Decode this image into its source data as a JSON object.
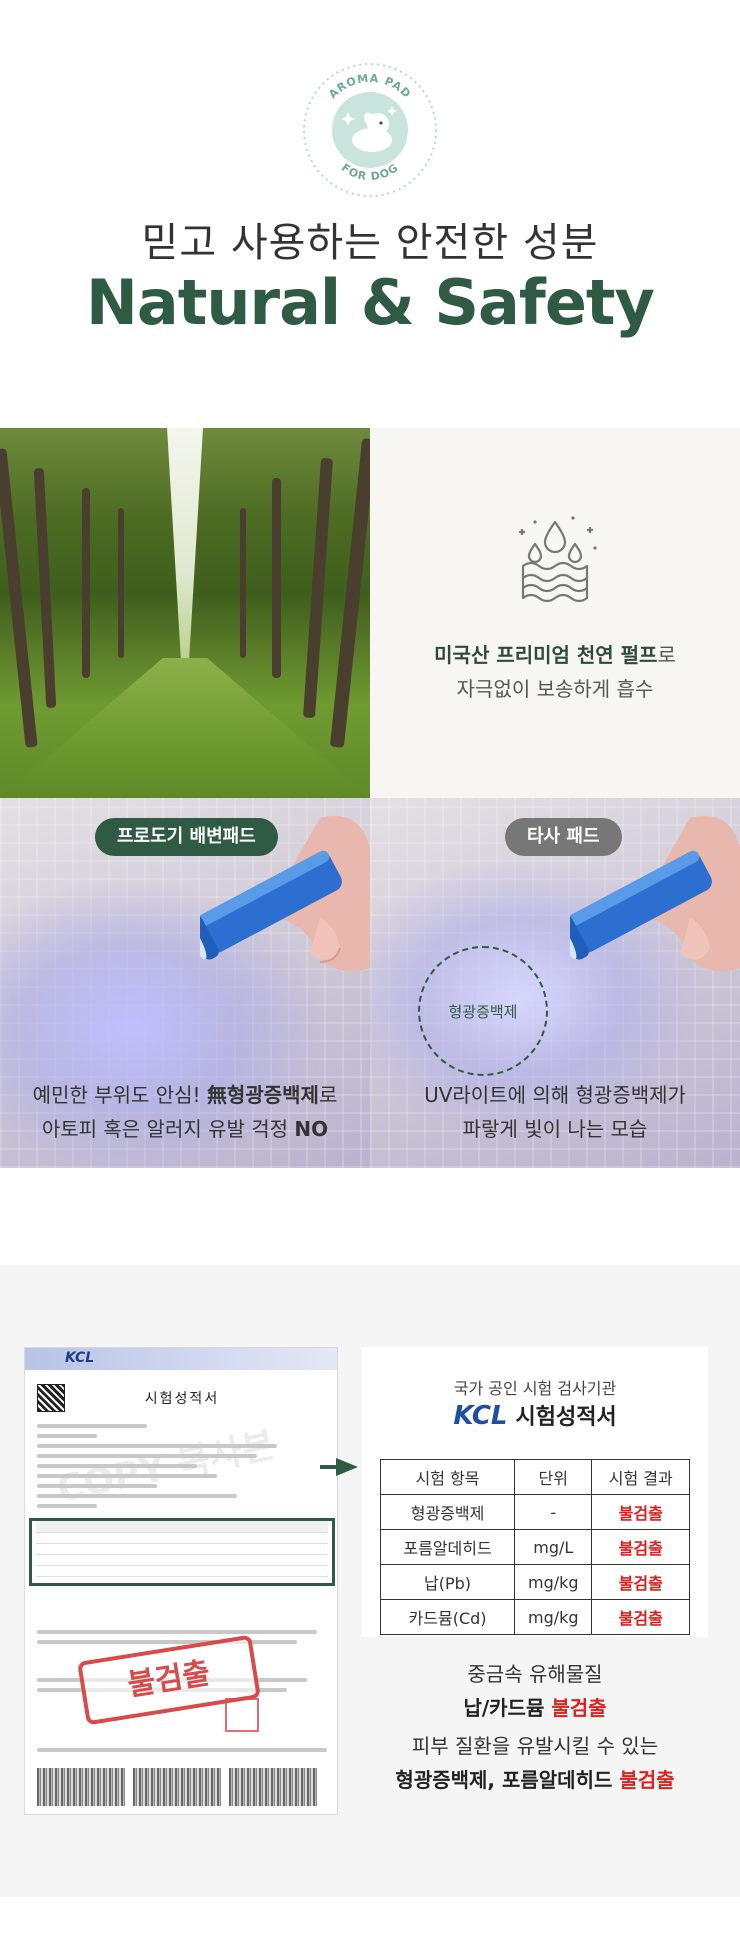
{
  "logo": {
    "top_text": "AROMA PAD",
    "bottom_text": "FOR DOG"
  },
  "header": {
    "title_ko": "믿고 사용하는 안전한 성분",
    "title_en": "Natural & Safety"
  },
  "pulp": {
    "highlight": "미국산 프리미엄 천연 펄프",
    "suffix": "로",
    "line2": "자극없이 보송하게 흡수"
  },
  "ours": {
    "badge": "프로도기 배변패드",
    "line1_prefix": "예민한 부위도 안심! ",
    "line1_bold": "無형광증백제",
    "line1_suffix": "로",
    "line2_prefix": "아토피 혹은 알러지 유발 걱정 ",
    "line2_bold": "NO"
  },
  "other": {
    "badge": "타사 패드",
    "circle_label": "형광증백제",
    "line1": "UV라이트에 의해 형광증백제가",
    "line2": "파랗게 빛이 나는 모습"
  },
  "document": {
    "brand": "KCL",
    "title": "시험성적서",
    "watermark": "COPY 복사본",
    "stamp": "불검출"
  },
  "results": {
    "subtitle": "국가 공인 시험 검사기관",
    "brand": "KCL",
    "title": "시험성적서",
    "headers": [
      "시험 항목",
      "단위",
      "시험 결과"
    ],
    "rows": [
      [
        "형광증백제",
        "-",
        "불검출"
      ],
      [
        "포름알데히드",
        "mg/L",
        "불검출"
      ],
      [
        "납(Pb)",
        "mg/kg",
        "불검출"
      ],
      [
        "카드뮴(Cd)",
        "mg/kg",
        "불검출"
      ]
    ]
  },
  "summary1": {
    "line1": "중금속 유해물질",
    "line2_bold": "납/카드뮴 ",
    "line2_red": "불검출"
  },
  "summary2": {
    "line1": "피부 질환을 유발시킬 수 있는",
    "line2_bold": "형광증백제, 포름알데히드 ",
    "line2_red": "불검출"
  },
  "colors": {
    "brand_green": "#2f5a43",
    "red": "#e02020",
    "kcl_blue": "#1f4fa0"
  }
}
